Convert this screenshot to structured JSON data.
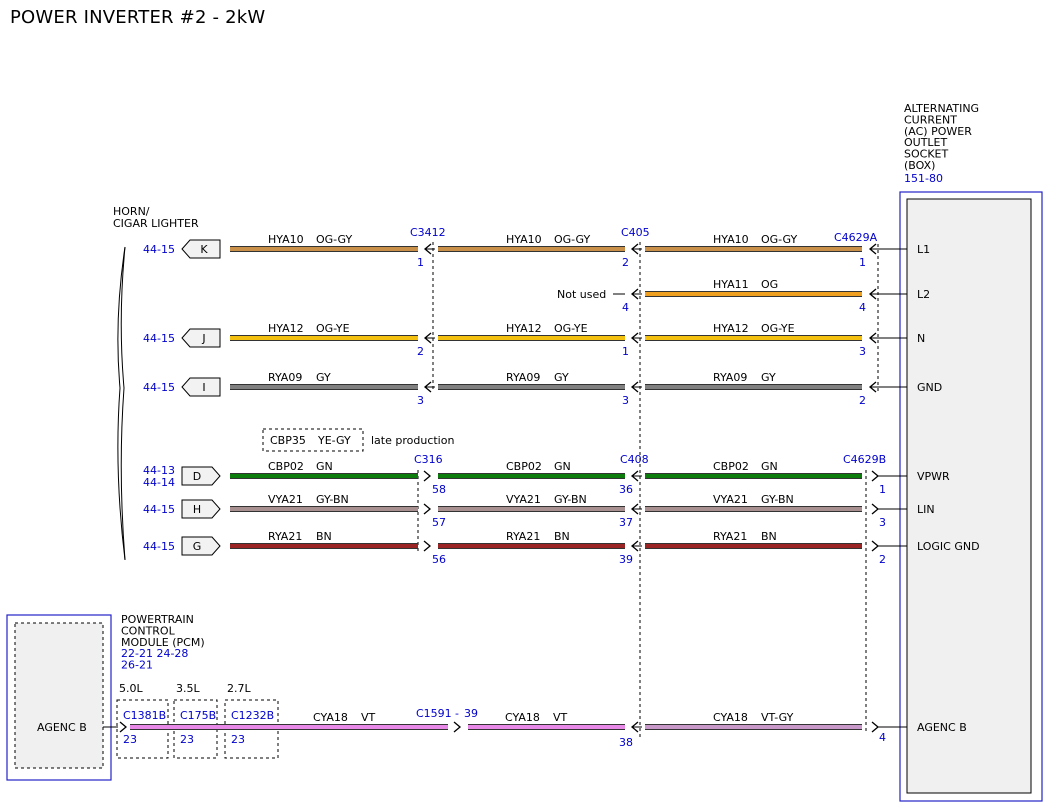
{
  "title": "POWER INVERTER #2 - 2kW",
  "colors": {
    "ref": "#0000cc",
    "box": "#2323c8",
    "OG": "#f0a020",
    "OG-GY": "#c89048",
    "OG-YE": "#f4c010",
    "GY": "#808080",
    "GN": "#0c7c0c",
    "GY-BN": "#a89090",
    "BN": "#9a2424",
    "VT": "#e889e8",
    "VT-GY": "#c898c8"
  },
  "outlet": {
    "lines": [
      "ALTERNATING",
      "CURRENT",
      "(AC) POWER",
      "OUTLET",
      "SOCKET",
      "(BOX)"
    ],
    "ref": "151-80",
    "pins": [
      "L1",
      "L2",
      "N",
      "GND",
      "VPWR",
      "LIN",
      "LOGIC GND",
      "AGENC B"
    ]
  },
  "horn": {
    "lines": [
      "HORN/",
      "CIGAR LIGHTER"
    ]
  },
  "pcm": {
    "lines": [
      "POWERTRAIN",
      "CONTROL",
      "MODULE (PCM)"
    ],
    "refs": [
      "22-21 24-28",
      "26-21"
    ],
    "pin": "AGENC B"
  },
  "connectors": [
    "C3412",
    "C405",
    "C4629A",
    "C316",
    "C408",
    "C4629B"
  ],
  "option_box": {
    "code": "CBP35",
    "color": "YE-GY",
    "note": "late production"
  },
  "not_used": "Not used",
  "engines": [
    "5.0L",
    "3.5L",
    "2.7L"
  ],
  "engine_connectors": [
    {
      "name": "C1381B",
      "pin": "23"
    },
    {
      "name": "C175B",
      "pin": "23"
    },
    {
      "name": "C1232B",
      "pin": "23"
    }
  ],
  "splice": {
    "label": "C1591",
    "pin": "39",
    "dash": "-"
  },
  "wires": [
    {
      "ref": [
        "44-15"
      ],
      "term": "K",
      "segs": [
        {
          "c": "HYA10",
          "col": "OG-GY"
        },
        {
          "c": "HYA10",
          "col": "OG-GY"
        },
        {
          "c": "HYA10",
          "col": "OG-GY"
        }
      ],
      "pins": [
        "1",
        "2",
        "1"
      ]
    },
    {
      "segs": [
        {
          "c": "HYA11",
          "col": "OG"
        }
      ],
      "pins": [
        "4",
        "4"
      ]
    },
    {
      "ref": [
        "44-15"
      ],
      "term": "J",
      "segs": [
        {
          "c": "HYA12",
          "col": "OG-YE"
        },
        {
          "c": "HYA12",
          "col": "OG-YE"
        },
        {
          "c": "HYA12",
          "col": "OG-YE"
        }
      ],
      "pins": [
        "2",
        "1",
        "3"
      ]
    },
    {
      "ref": [
        "44-15"
      ],
      "term": "I",
      "segs": [
        {
          "c": "RYA09",
          "col": "GY"
        },
        {
          "c": "RYA09",
          "col": "GY"
        },
        {
          "c": "RYA09",
          "col": "GY"
        }
      ],
      "pins": [
        "3",
        "3",
        "2"
      ]
    },
    {
      "ref": [
        "44-13",
        "44-14"
      ],
      "term": "D",
      "segs": [
        {
          "c": "CBP02",
          "col": "GN"
        },
        {
          "c": "CBP02",
          "col": "GN"
        },
        {
          "c": "CBP02",
          "col": "GN"
        }
      ],
      "pins": [
        "58",
        "36",
        "1"
      ]
    },
    {
      "ref": [
        "44-15"
      ],
      "term": "H",
      "segs": [
        {
          "c": "VYA21",
          "col": "GY-BN"
        },
        {
          "c": "VYA21",
          "col": "GY-BN"
        },
        {
          "c": "VYA21",
          "col": "GY-BN"
        }
      ],
      "pins": [
        "57",
        "37",
        "3"
      ]
    },
    {
      "ref": [
        "44-15"
      ],
      "term": "G",
      "segs": [
        {
          "c": "RYA21",
          "col": "BN"
        },
        {
          "c": "RYA21",
          "col": "BN"
        },
        {
          "c": "RYA21",
          "col": "BN"
        }
      ],
      "pins": [
        "56",
        "39",
        "2"
      ]
    },
    {
      "segs": [
        {
          "c": "CYA18",
          "col": "VT"
        },
        {
          "c": "CYA18",
          "col": "VT"
        },
        {
          "c": "CYA18",
          "col": "VT-GY"
        }
      ],
      "pins": [
        "38",
        "4"
      ]
    }
  ]
}
